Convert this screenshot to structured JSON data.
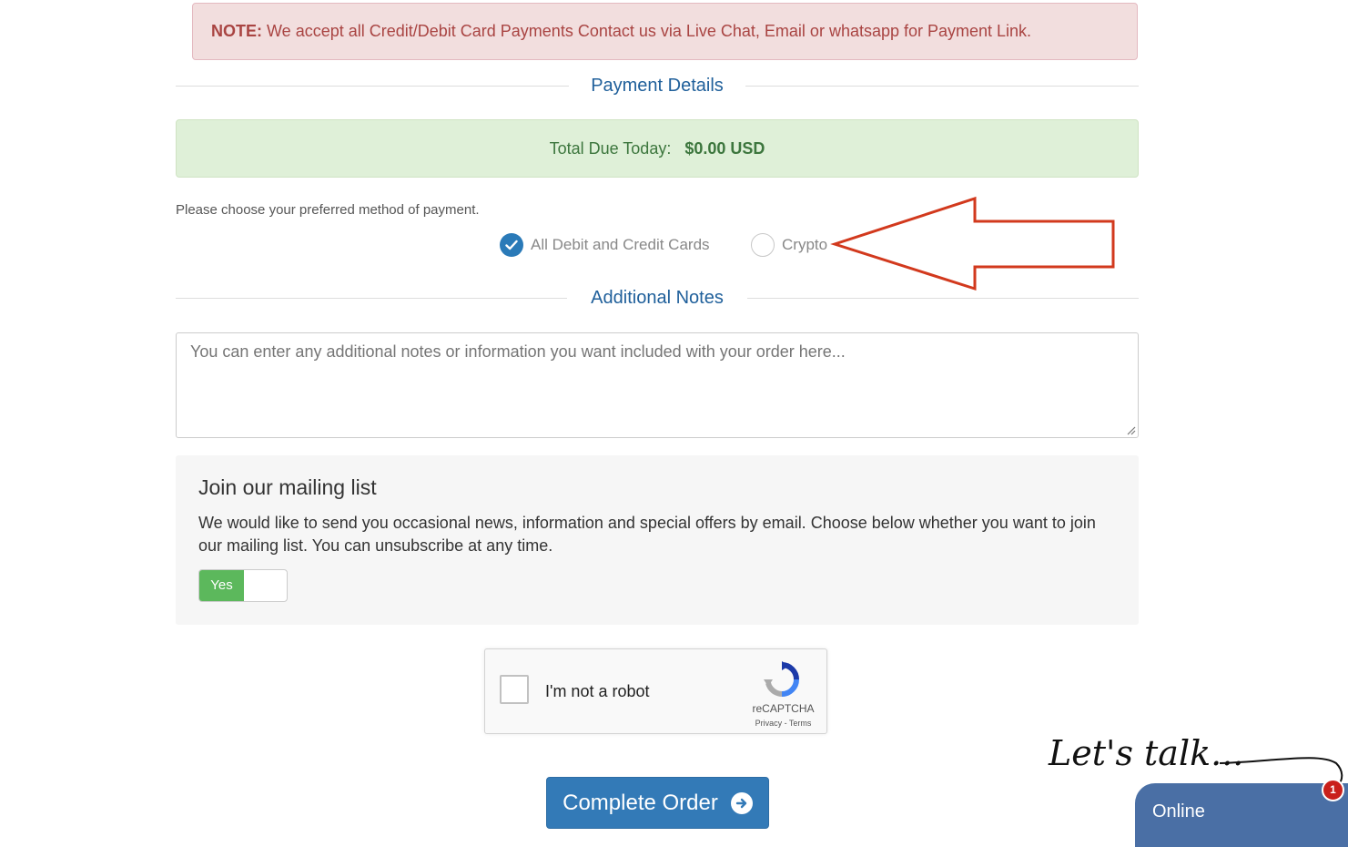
{
  "note": {
    "prefix": "NOTE:",
    "text": "We accept all Credit/Debit Card Payments Contact us via Live Chat, Email or whatsapp for Payment Link."
  },
  "payment": {
    "heading": "Payment Details",
    "total_label": "Total Due Today:",
    "total_amount": "$0.00 USD",
    "choose_label": "Please choose your preferred method of payment.",
    "methods": [
      {
        "label": "All Debit and Credit Cards",
        "selected": true
      },
      {
        "label": "Crypto",
        "selected": false
      }
    ]
  },
  "notes": {
    "heading": "Additional Notes",
    "placeholder": "You can enter any additional notes or information you want included with your order here..."
  },
  "mailing": {
    "heading": "Join our mailing list",
    "text": "We would like to send you occasional news, information and special offers by email. Choose below whether you want to join our mailing list. You can unsubscribe at any time.",
    "toggle_label": "Yes",
    "toggle_on": true
  },
  "recaptcha": {
    "label": "I'm not a robot",
    "brand": "reCAPTCHA",
    "links": "Privacy - Terms"
  },
  "submit": {
    "label": "Complete Order",
    "icon": "arrow-circle-right-icon"
  },
  "chat": {
    "tagline": "Let's talk...",
    "status": "Online",
    "badge_count": "1"
  },
  "colors": {
    "primary": "#337ab7",
    "section_heading": "#20609b",
    "success": "#5cb85c",
    "annotation_arrow": "#d2391d",
    "chat": "#4a6fa5"
  }
}
